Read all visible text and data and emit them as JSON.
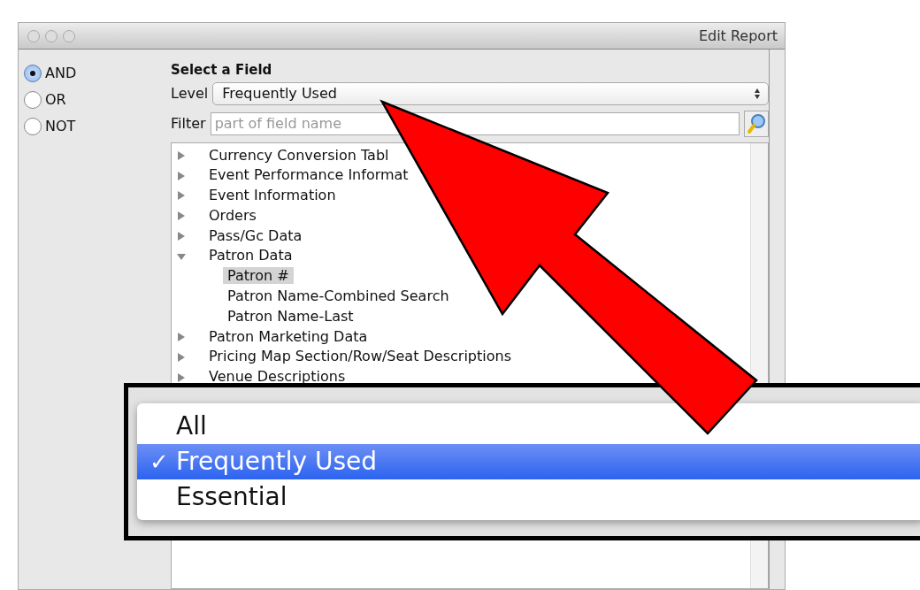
{
  "window": {
    "title": "Edit Report"
  },
  "logic_options": [
    {
      "label": "AND",
      "selected": true
    },
    {
      "label": "OR",
      "selected": false
    },
    {
      "label": "NOT",
      "selected": false
    }
  ],
  "field_picker": {
    "heading": "Select a Field",
    "level_label": "Level",
    "level_value": "Frequently Used",
    "filter_label": "Filter",
    "filter_placeholder": "part of field name"
  },
  "tree": [
    {
      "label": "Currency Conversion Tabl",
      "expanded": false
    },
    {
      "label": "Event Performance Informat",
      "expanded": false
    },
    {
      "label": "Event Information",
      "expanded": false
    },
    {
      "label": "Orders",
      "expanded": false
    },
    {
      "label": "Pass/Gc Data",
      "expanded": false
    },
    {
      "label": "Patron Data",
      "expanded": true,
      "children": [
        {
          "label": "Patron #",
          "selected": true
        },
        {
          "label": "Patron Name-Combined Search",
          "selected": false
        },
        {
          "label": "Patron Name-Last",
          "selected": false
        }
      ]
    },
    {
      "label": "Patron Marketing Data",
      "expanded": false
    },
    {
      "label": "Pricing Map Section/Row/Seat Descriptions",
      "expanded": false
    },
    {
      "label": "Venue Descriptions",
      "expanded": false
    }
  ],
  "level_menu": {
    "check_mark": "✓",
    "options": [
      {
        "label": "All",
        "selected": false
      },
      {
        "label": "Frequently Used",
        "selected": true
      },
      {
        "label": "Essential",
        "selected": false
      }
    ]
  }
}
